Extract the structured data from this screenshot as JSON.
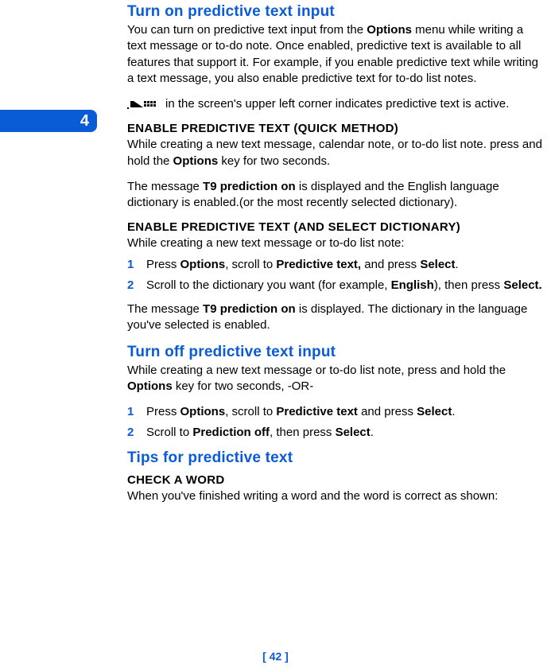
{
  "chapter": "4",
  "section1_title": "Turn on predictive text input",
  "p1_a": "You can turn on predictive text input from the ",
  "p1_bold1": "Options",
  "p1_b": " menu while writing a text message or to-do note. Once enabled, predictive text is available to all features that support it. For example, if you enable predictive text while writing a text message, you also enable predictive text for to-do list notes.",
  "p_icon_after": " in the screen's upper left corner indicates predictive text is active.",
  "h_quick": "ENABLE PREDICTIVE TEXT (QUICK METHOD)",
  "p2_a": "While creating a new text message, calendar note, or to-do list note. press and hold the ",
  "p2_bold1": "Options",
  "p2_b": " key for two seconds.",
  "p3_a": "The message ",
  "p3_bold1": "T9 prediction on",
  "p3_b": " is displayed and the English language dictionary is enabled.(or the most recently selected dictionary).",
  "h_dict": "ENABLE PREDICTIVE TEXT (AND SELECT DICTIONARY)",
  "p4": "While creating a new text message or to-do list note:",
  "steps_a": {
    "s1": {
      "num": "1",
      "a": "Press ",
      "b1": "Options",
      "b": ", scroll to ",
      "b2": "Predictive text,",
      "c": " and press ",
      "b3": "Select",
      "d": "."
    },
    "s2": {
      "num": "2",
      "a": "Scroll to the dictionary you want (for example, ",
      "b1": "English",
      "b": "), then press ",
      "b2": "Select.",
      "c": ""
    }
  },
  "p5_a": "The message ",
  "p5_bold1": "T9 prediction on",
  "p5_b": " is displayed. The dictionary in the language you've selected is enabled.",
  "section2_title": "Turn off predictive text input",
  "p6_a": "While creating a new text message or to-do list note, press and hold the ",
  "p6_bold1": "Options",
  "p6_b": " key for two seconds, -OR-",
  "steps_b": {
    "s1": {
      "num": "1",
      "a": "Press ",
      "b1": "Options",
      "b": ", scroll to ",
      "b2": "Predictive text",
      "c": " and press ",
      "b3": "Select",
      "d": "."
    },
    "s2": {
      "num": "2",
      "a": "Scroll to ",
      "b1": "Prediction off",
      "b": ", then press ",
      "b2": "Select",
      "c": "."
    }
  },
  "section3_title": "Tips for predictive text",
  "h_check": "CHECK A WORD",
  "p7": "When you've finished writing a word and the word is correct as shown:",
  "footer": "[ 42 ]"
}
